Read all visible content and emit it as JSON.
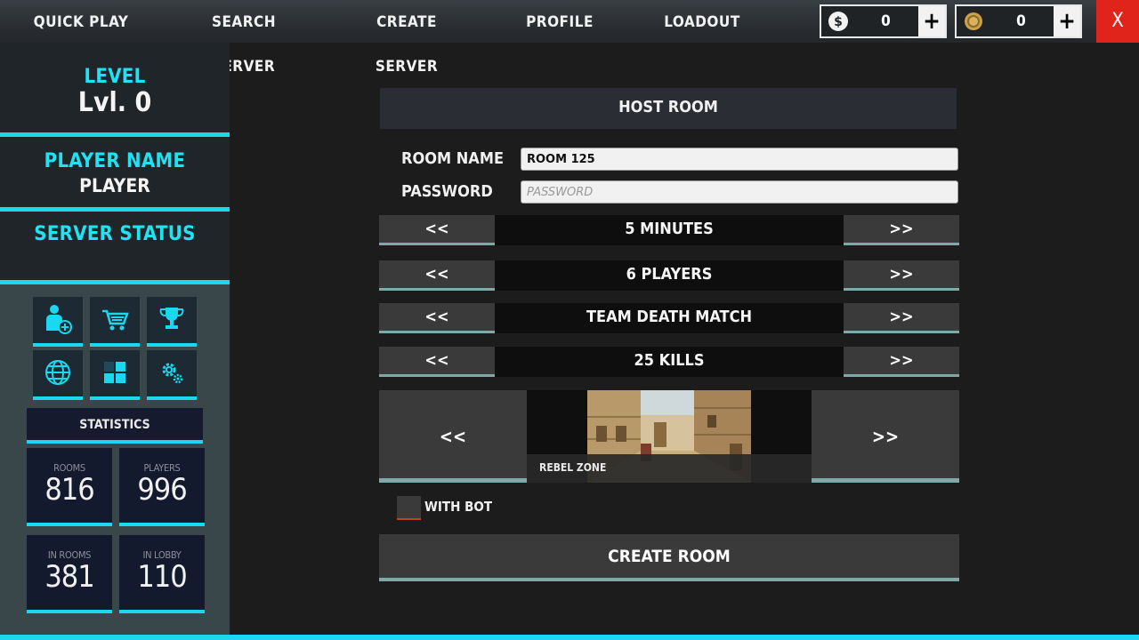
{
  "nav": {
    "quick_play": "QUICK PLAY",
    "search_server": "SEARCH SERVER",
    "create_server": "CREATE SERVER",
    "profile": "PROFILE",
    "loadout": "LOADOUT"
  },
  "currency": {
    "cash": {
      "icon": "dollar-coin-icon",
      "value": "0",
      "plus": "+"
    },
    "gold": {
      "icon": "gold-coin-icon",
      "value": "0",
      "plus": "+"
    }
  },
  "close_label": "X",
  "sidebar": {
    "level_label": "LEVEL",
    "level_value": "Lvl. 0",
    "player_name_label": "PLAYER NAME",
    "player_name_value": "PLAYER",
    "server_status_label": "SERVER STATUS",
    "tiles": [
      "add-friend-icon",
      "shop-cart-icon",
      "trophy-icon",
      "globe-icon",
      "inventory-grid-icon",
      "settings-gears-icon"
    ],
    "statistics_label": "STATISTICS",
    "stats": {
      "rooms_label": "ROOMS",
      "rooms_value": "816",
      "players_label": "PLAYERS",
      "players_value": "996",
      "in_rooms_label": "IN ROOMS",
      "in_rooms_value": "381",
      "in_lobby_label": "IN LOBBY",
      "in_lobby_value": "110"
    }
  },
  "host": {
    "title": "HOST ROOM",
    "room_name_label": "ROOM NAME",
    "room_name_value": "ROOM 125",
    "password_label": "PASSWORD",
    "password_placeholder": "PASSWORD",
    "prev": "<<",
    "next": ">>",
    "time": "5 MINUTES",
    "players": "6 PLAYERS",
    "mode": "TEAM DEATH MATCH",
    "kills": "25 KILLS",
    "map_name": "REBEL ZONE",
    "with_bot_label": "WITH BOT",
    "create_label": "CREATE ROOM"
  },
  "colors": {
    "accent": "#1ad8f0",
    "close": "#e0241b",
    "button_underline": "#7fa8a8"
  }
}
